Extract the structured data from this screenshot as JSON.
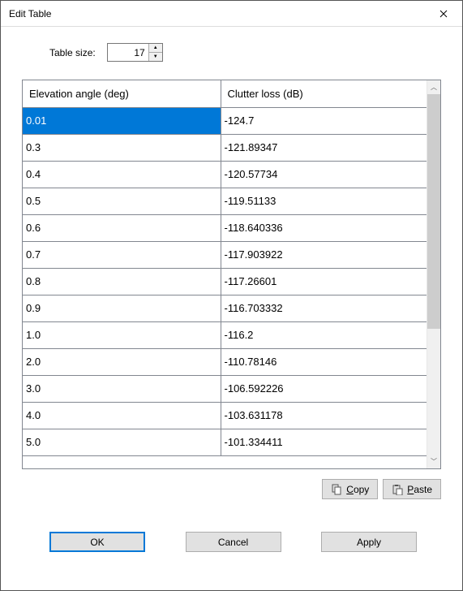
{
  "window": {
    "title": "Edit Table"
  },
  "size": {
    "label": "Table size:",
    "value": "17"
  },
  "table": {
    "columns": [
      "Elevation angle (deg)",
      "Clutter loss (dB)"
    ],
    "rows": [
      {
        "a": "0.01",
        "b": "-124.7",
        "selected": true
      },
      {
        "a": "0.3",
        "b": "-121.89347"
      },
      {
        "a": "0.4",
        "b": "-120.57734"
      },
      {
        "a": "0.5",
        "b": "-119.51133"
      },
      {
        "a": "0.6",
        "b": "-118.640336"
      },
      {
        "a": "0.7",
        "b": "-117.903922"
      },
      {
        "a": "0.8",
        "b": "-117.26601"
      },
      {
        "a": "0.9",
        "b": "-116.703332"
      },
      {
        "a": "1.0",
        "b": "-116.2"
      },
      {
        "a": "2.0",
        "b": "-110.78146"
      },
      {
        "a": "3.0",
        "b": "-106.592226"
      },
      {
        "a": "4.0",
        "b": "-103.631178"
      },
      {
        "a": "5.0",
        "b": "-101.334411"
      }
    ]
  },
  "buttons": {
    "copy": "Copy",
    "paste": "Paste",
    "ok": "OK",
    "cancel": "Cancel",
    "apply": "Apply"
  }
}
